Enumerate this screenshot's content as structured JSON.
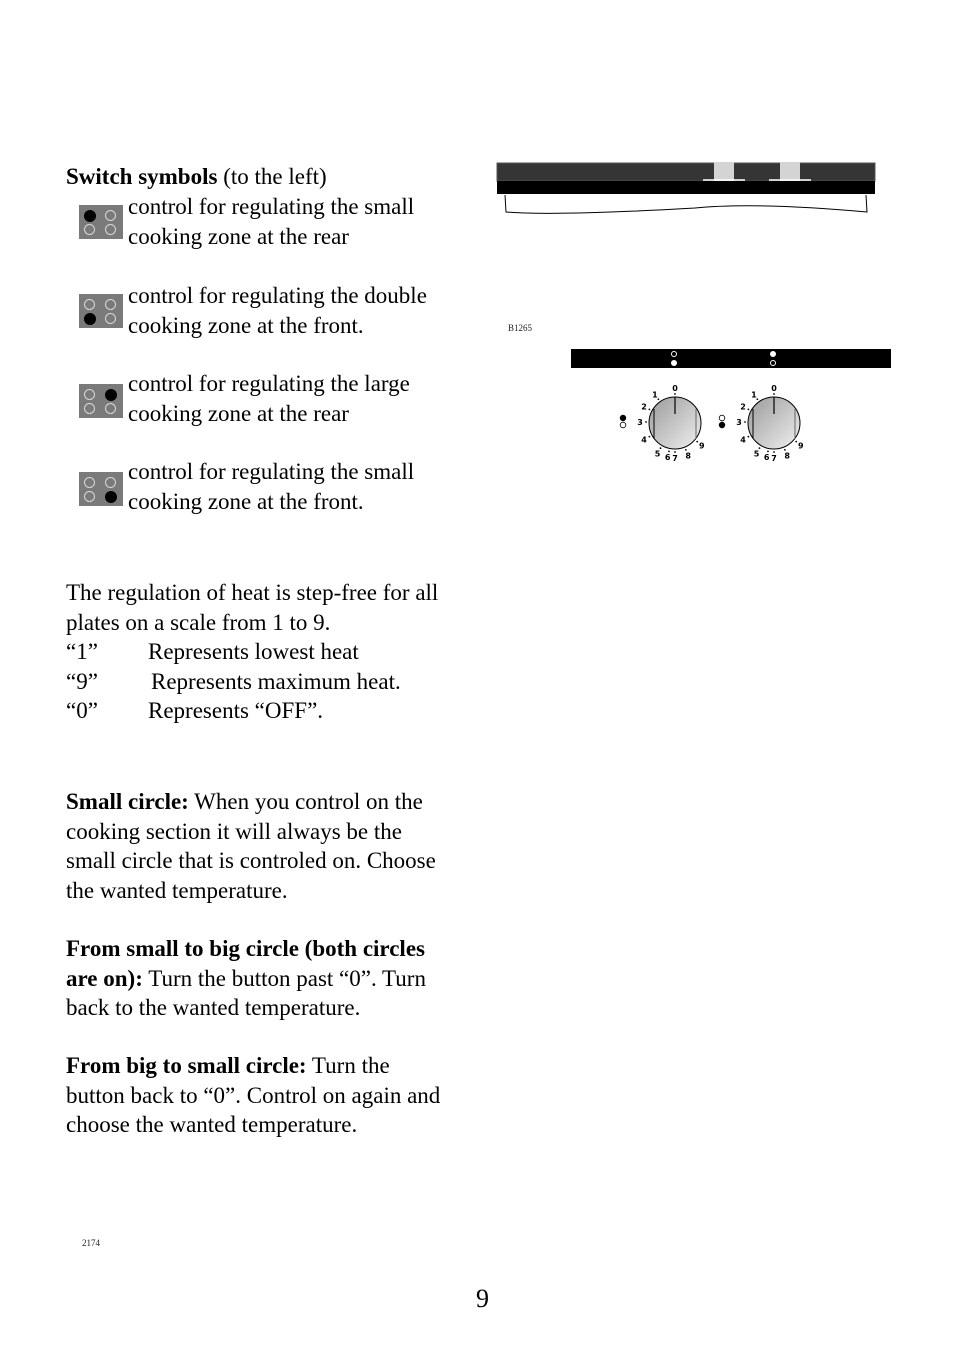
{
  "switch_symbols": {
    "heading_bold": "Switch symbols",
    "heading_rest": " (to the left)",
    "items": [
      {
        "active": "top-left",
        "line1": "control for regulating the small",
        "line2": "cooking zone at the rear"
      },
      {
        "active": "bottom-left",
        "line1": "control for regulating the double",
        "line2": "cooking zone at the front."
      },
      {
        "active": "top-right",
        "line1": "control for regulating the large",
        "line2": "cooking zone at the rear"
      },
      {
        "active": "bottom-right",
        "line1": "control for regulating the small",
        "line2": "cooking zone at the front."
      }
    ]
  },
  "heat_regulation": {
    "line1": "The regulation of heat is step-free for all",
    "line2": "plates on a scale from 1 to 9.",
    "scale": [
      {
        "value": "“1”",
        "meaning": "Represents lowest heat"
      },
      {
        "value": "“9”",
        "meaning": "Represents maximum heat."
      },
      {
        "value": "“0”",
        "meaning": "Represents “OFF”."
      }
    ]
  },
  "small_circle": {
    "bold": "Small circle:",
    "lines": [
      " When you control on the",
      "cooking section it will always be the",
      "small circle that is controled on. Choose",
      "the wanted temperature."
    ]
  },
  "small_to_big": {
    "bold1": "From small to big circle (both circles",
    "bold2": "are on):",
    "rest2": " Turn the button past “0”. Turn",
    "line3": "back to the wanted temperature."
  },
  "big_to_small": {
    "bold": "From big to small circle:",
    "rest1": " Turn the",
    "line2": "button back to “0”. Control on again and",
    "line3": "choose the wanted temperature."
  },
  "figure": {
    "label": "B1265",
    "dial_numbers": [
      "0",
      "1",
      "2",
      "3",
      "4",
      "5",
      "6",
      "7",
      "8",
      "9"
    ]
  },
  "footer": {
    "code": "2174",
    "page_number": "9"
  }
}
